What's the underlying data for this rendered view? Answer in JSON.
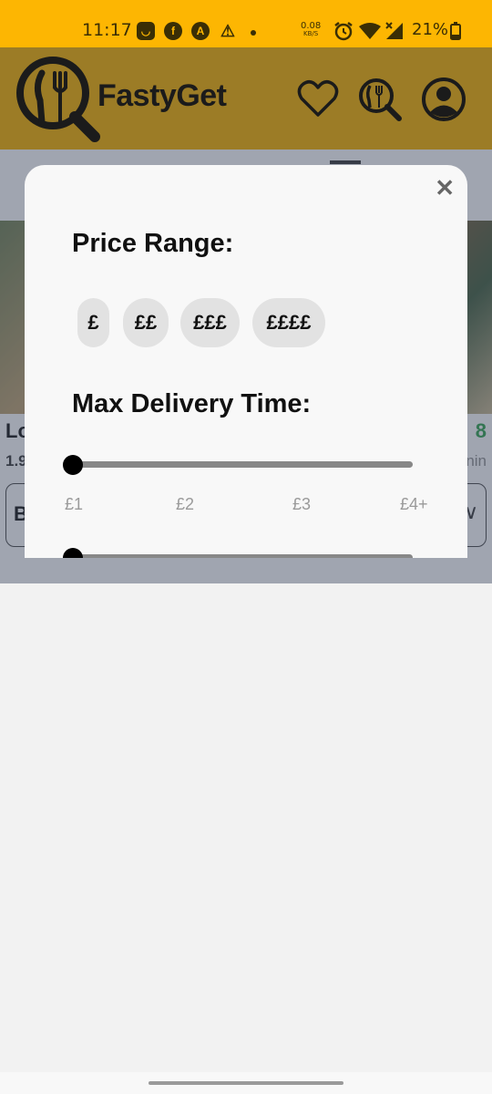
{
  "status_bar": {
    "time": "11:17",
    "speed_value": "0.08",
    "speed_unit": "KB/S",
    "battery": "21%",
    "icons": [
      "app-notification-icon",
      "facebook-icon",
      "app-a-icon",
      "warning-icon",
      "alarm-icon",
      "wifi-icon",
      "signal-icon",
      "battery-icon"
    ]
  },
  "header": {
    "brand": "FastyGet",
    "icons": [
      "logo-icon",
      "favorites-heart-icon",
      "search-food-icon",
      "profile-icon"
    ],
    "background_color": "#9c7c26"
  },
  "background_content": {
    "title_fragment": "Lo",
    "subtitle_fragment": "1.9",
    "right_number_fragment": "8",
    "right_sub_fragment": "nin",
    "input_fragment": "B"
  },
  "modal": {
    "price_range_label": "Price Range:",
    "price_options": [
      "£",
      "££",
      "£££",
      "££££"
    ],
    "delivery_label": "Max Delivery Time:",
    "slider_ticks": [
      "£1",
      "£2",
      "£3",
      "£4+"
    ],
    "slider_value": "£1"
  }
}
